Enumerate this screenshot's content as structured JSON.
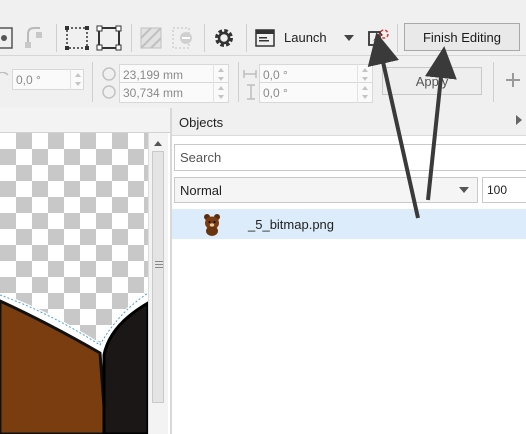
{
  "toolbar": {
    "launch_label": "Launch",
    "finish_editing_label": "Finish Editing"
  },
  "property_bar": {
    "angle_value": "0,0 °",
    "size_width": "23,199 mm",
    "size_height": "30,734 mm",
    "skew_h": "0,0 °",
    "skew_v": "0,0 °",
    "apply_label": "Apply"
  },
  "objects_panel": {
    "title": "Objects",
    "search_placeholder": "Search",
    "blend_mode": "Normal",
    "opacity": "100",
    "layers": [
      {
        "name": "_5_bitmap.png",
        "icon": "bear-thumbnail-icon"
      }
    ]
  },
  "colors": {
    "selection_row": "#dcecfb",
    "annotation_arrow": "#3a3a3a",
    "bitmap_brown": "#7a3d10"
  }
}
